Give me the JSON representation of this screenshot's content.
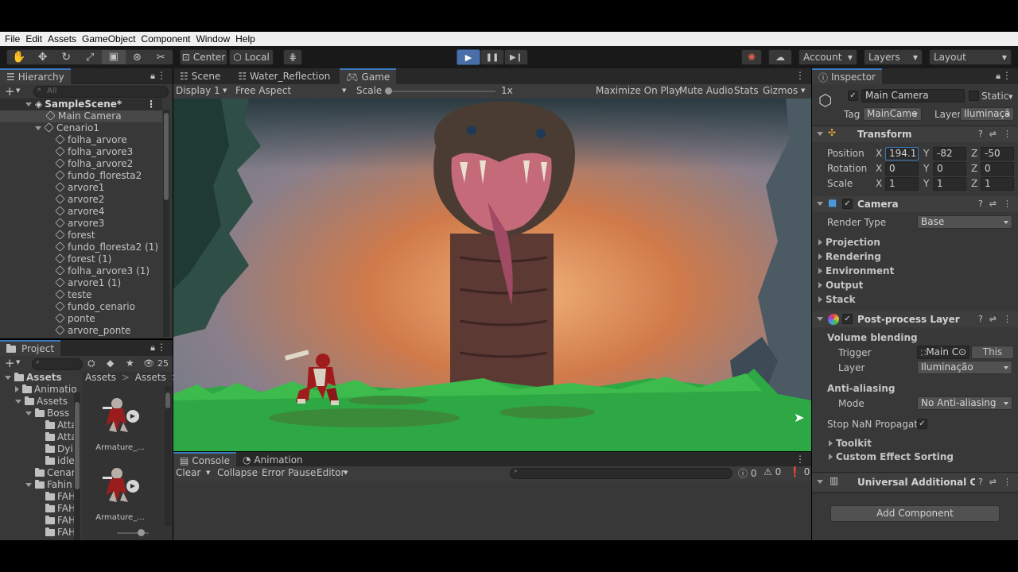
{
  "menu": [
    "File",
    "Edit",
    "Assets",
    "GameObject",
    "Component",
    "Window",
    "Help"
  ],
  "toolbar": {
    "pivot": "Center",
    "space": "Local",
    "account": "Account",
    "layers": "Layers",
    "layout": "Layout"
  },
  "hierarchy": {
    "tab": "Hierarchy",
    "search_placeholder": "All",
    "scene": "SampleScene*",
    "items": [
      "Main Camera",
      "Cenario1",
      "folha_arvore",
      "folha_arvore3",
      "folha_arvore2",
      "fundo_floresta2",
      "arvore1",
      "arvore2",
      "arvore4",
      "arvore3",
      "forest",
      "fundo_floresta2 (1)",
      "forest (1)",
      "folha_arvore3 (1)",
      "arvore1 (1)",
      "teste",
      "fundo_cenario",
      "ponte",
      "arvore_ponte"
    ]
  },
  "project": {
    "tab": "Project",
    "hidden_count": "25",
    "breadcrumb": [
      "Assets",
      "Assets",
      "F"
    ],
    "tree": [
      {
        "label": "Assets",
        "indent": 0,
        "expanded": true,
        "bold": true
      },
      {
        "label": "Animatio",
        "indent": 1,
        "expanded": false
      },
      {
        "label": "Assets",
        "indent": 1,
        "expanded": true
      },
      {
        "label": "Boss",
        "indent": 2,
        "expanded": true
      },
      {
        "label": "Atta",
        "indent": 3
      },
      {
        "label": "Atta",
        "indent": 3
      },
      {
        "label": "Dyi",
        "indent": 3
      },
      {
        "label": "idle",
        "indent": 3
      },
      {
        "label": "Cenar",
        "indent": 2
      },
      {
        "label": "Fahin",
        "indent": 2,
        "expanded": true
      },
      {
        "label": "FAH",
        "indent": 3
      },
      {
        "label": "FAH",
        "indent": 3
      },
      {
        "label": "FAH",
        "indent": 3
      },
      {
        "label": "FAH",
        "indent": 3
      }
    ],
    "assets": [
      "Armature_...",
      "Armature_..."
    ]
  },
  "scene_tabs": [
    "Scene",
    "Water_Reflection",
    "Game"
  ],
  "game_bar": {
    "display": "Display 1",
    "aspect": "Free Aspect",
    "scale_label": "Scale",
    "scale_value": "1x",
    "maximize": "Maximize On Play",
    "mute": "Mute Audio",
    "stats": "Stats",
    "gizmos": "Gizmos"
  },
  "console": {
    "tabs": [
      "Console",
      "Animation"
    ],
    "clear": "Clear",
    "collapse": "Collapse",
    "error_pause": "Error Pause",
    "editor": "Editor",
    "counts": [
      "0",
      "0",
      "0"
    ]
  },
  "inspector": {
    "tab": "Inspector",
    "object_name": "Main Camera",
    "static_label": "Static",
    "tag_label": "Tag",
    "tag_value": "MainCame",
    "layer_label": "Layer",
    "layer_value": "Iluminaçã",
    "transform": {
      "title": "Transform",
      "rows": [
        {
          "label": "Position",
          "x": "194.1",
          "y": "-82",
          "z": "-50"
        },
        {
          "label": "Rotation",
          "x": "0",
          "y": "0",
          "z": "0"
        },
        {
          "label": "Scale",
          "x": "1",
          "y": "1",
          "z": "1"
        }
      ]
    },
    "camera": {
      "title": "Camera",
      "render_type_label": "Render Type",
      "render_type_value": "Base",
      "foldouts": [
        "Projection",
        "Rendering",
        "Environment",
        "Output",
        "Stack"
      ]
    },
    "post_process": {
      "title": "Post-process Layer",
      "volume_blending": "Volume blending",
      "trigger_label": "Trigger",
      "trigger_value": "Main C",
      "this_button": "This",
      "layer_label": "Layer",
      "layer_value": "Iluminação",
      "anti_aliasing": "Anti-aliasing",
      "mode_label": "Mode",
      "mode_value": "No Anti-aliasing",
      "stop_nan": "Stop NaN Propagatio",
      "toolkit": "Toolkit",
      "custom_sorting": "Custom Effect Sorting"
    },
    "universal": "Universal Additional Cam",
    "add_component": "Add Component"
  },
  "colors": {
    "accent": "#3a79bb",
    "play_active": "#4a6ea8",
    "panel": "#383838",
    "toolbar": "#191919"
  }
}
